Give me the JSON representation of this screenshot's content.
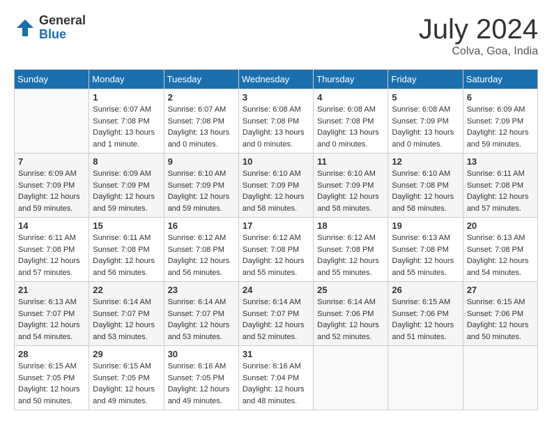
{
  "logo": {
    "general": "General",
    "blue": "Blue"
  },
  "header": {
    "month": "July 2024",
    "location": "Colva, Goa, India"
  },
  "weekdays": [
    "Sunday",
    "Monday",
    "Tuesday",
    "Wednesday",
    "Thursday",
    "Friday",
    "Saturday"
  ],
  "weeks": [
    [
      {
        "day": "",
        "info": ""
      },
      {
        "day": "1",
        "info": "Sunrise: 6:07 AM\nSunset: 7:08 PM\nDaylight: 13 hours\nand 1 minute."
      },
      {
        "day": "2",
        "info": "Sunrise: 6:07 AM\nSunset: 7:08 PM\nDaylight: 13 hours\nand 0 minutes."
      },
      {
        "day": "3",
        "info": "Sunrise: 6:08 AM\nSunset: 7:08 PM\nDaylight: 13 hours\nand 0 minutes."
      },
      {
        "day": "4",
        "info": "Sunrise: 6:08 AM\nSunset: 7:08 PM\nDaylight: 13 hours\nand 0 minutes."
      },
      {
        "day": "5",
        "info": "Sunrise: 6:08 AM\nSunset: 7:09 PM\nDaylight: 13 hours\nand 0 minutes."
      },
      {
        "day": "6",
        "info": "Sunrise: 6:09 AM\nSunset: 7:09 PM\nDaylight: 12 hours\nand 59 minutes."
      }
    ],
    [
      {
        "day": "7",
        "info": "Sunrise: 6:09 AM\nSunset: 7:09 PM\nDaylight: 12 hours\nand 59 minutes."
      },
      {
        "day": "8",
        "info": "Sunrise: 6:09 AM\nSunset: 7:09 PM\nDaylight: 12 hours\nand 59 minutes."
      },
      {
        "day": "9",
        "info": "Sunrise: 6:10 AM\nSunset: 7:09 PM\nDaylight: 12 hours\nand 59 minutes."
      },
      {
        "day": "10",
        "info": "Sunrise: 6:10 AM\nSunset: 7:09 PM\nDaylight: 12 hours\nand 58 minutes."
      },
      {
        "day": "11",
        "info": "Sunrise: 6:10 AM\nSunset: 7:09 PM\nDaylight: 12 hours\nand 58 minutes."
      },
      {
        "day": "12",
        "info": "Sunrise: 6:10 AM\nSunset: 7:08 PM\nDaylight: 12 hours\nand 58 minutes."
      },
      {
        "day": "13",
        "info": "Sunrise: 6:11 AM\nSunset: 7:08 PM\nDaylight: 12 hours\nand 57 minutes."
      }
    ],
    [
      {
        "day": "14",
        "info": "Sunrise: 6:11 AM\nSunset: 7:08 PM\nDaylight: 12 hours\nand 57 minutes."
      },
      {
        "day": "15",
        "info": "Sunrise: 6:11 AM\nSunset: 7:08 PM\nDaylight: 12 hours\nand 56 minutes."
      },
      {
        "day": "16",
        "info": "Sunrise: 6:12 AM\nSunset: 7:08 PM\nDaylight: 12 hours\nand 56 minutes."
      },
      {
        "day": "17",
        "info": "Sunrise: 6:12 AM\nSunset: 7:08 PM\nDaylight: 12 hours\nand 55 minutes."
      },
      {
        "day": "18",
        "info": "Sunrise: 6:12 AM\nSunset: 7:08 PM\nDaylight: 12 hours\nand 55 minutes."
      },
      {
        "day": "19",
        "info": "Sunrise: 6:13 AM\nSunset: 7:08 PM\nDaylight: 12 hours\nand 55 minutes."
      },
      {
        "day": "20",
        "info": "Sunrise: 6:13 AM\nSunset: 7:08 PM\nDaylight: 12 hours\nand 54 minutes."
      }
    ],
    [
      {
        "day": "21",
        "info": "Sunrise: 6:13 AM\nSunset: 7:07 PM\nDaylight: 12 hours\nand 54 minutes."
      },
      {
        "day": "22",
        "info": "Sunrise: 6:14 AM\nSunset: 7:07 PM\nDaylight: 12 hours\nand 53 minutes."
      },
      {
        "day": "23",
        "info": "Sunrise: 6:14 AM\nSunset: 7:07 PM\nDaylight: 12 hours\nand 53 minutes."
      },
      {
        "day": "24",
        "info": "Sunrise: 6:14 AM\nSunset: 7:07 PM\nDaylight: 12 hours\nand 52 minutes."
      },
      {
        "day": "25",
        "info": "Sunrise: 6:14 AM\nSunset: 7:06 PM\nDaylight: 12 hours\nand 52 minutes."
      },
      {
        "day": "26",
        "info": "Sunrise: 6:15 AM\nSunset: 7:06 PM\nDaylight: 12 hours\nand 51 minutes."
      },
      {
        "day": "27",
        "info": "Sunrise: 6:15 AM\nSunset: 7:06 PM\nDaylight: 12 hours\nand 50 minutes."
      }
    ],
    [
      {
        "day": "28",
        "info": "Sunrise: 6:15 AM\nSunset: 7:05 PM\nDaylight: 12 hours\nand 50 minutes."
      },
      {
        "day": "29",
        "info": "Sunrise: 6:15 AM\nSunset: 7:05 PM\nDaylight: 12 hours\nand 49 minutes."
      },
      {
        "day": "30",
        "info": "Sunrise: 6:16 AM\nSunset: 7:05 PM\nDaylight: 12 hours\nand 49 minutes."
      },
      {
        "day": "31",
        "info": "Sunrise: 6:16 AM\nSunset: 7:04 PM\nDaylight: 12 hours\nand 48 minutes."
      },
      {
        "day": "",
        "info": ""
      },
      {
        "day": "",
        "info": ""
      },
      {
        "day": "",
        "info": ""
      }
    ]
  ]
}
